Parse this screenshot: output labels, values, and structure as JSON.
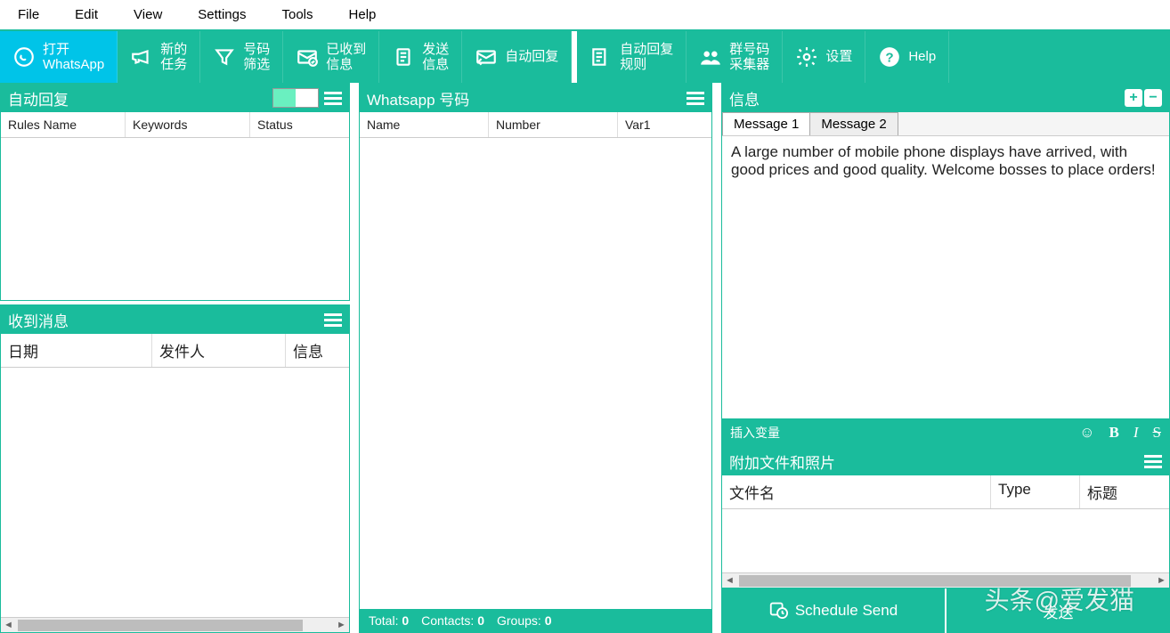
{
  "menubar": [
    "File",
    "Edit",
    "View",
    "Settings",
    "Tools",
    "Help"
  ],
  "toolbar": [
    {
      "id": "open-whatsapp",
      "label": "打开\nWhatsApp",
      "icon": "whatsapp",
      "active": true
    },
    {
      "id": "new-task",
      "label": "新的\n任务",
      "icon": "megaphone"
    },
    {
      "id": "number-filter",
      "label": "号码\n筛选",
      "icon": "funnel"
    },
    {
      "id": "received-msgs",
      "label": "已收到\n信息",
      "icon": "envelope-check"
    },
    {
      "id": "send-msgs",
      "label": "发送\n信息",
      "icon": "clipboard"
    },
    {
      "id": "auto-reply",
      "label": "自动回复",
      "icon": "reply"
    },
    {
      "id": "auto-reply-rules",
      "label": "自动回复\n规则",
      "icon": "rules",
      "gapBefore": true
    },
    {
      "id": "group-collector",
      "label": "群号码\n采集器",
      "icon": "people"
    },
    {
      "id": "settings",
      "label": "设置",
      "icon": "gear"
    },
    {
      "id": "help",
      "label": "Help",
      "icon": "help"
    }
  ],
  "panels": {
    "autoReply": {
      "title": "自动回复",
      "columns": [
        "Rules Name",
        "Keywords",
        "Status"
      ]
    },
    "received": {
      "title": "收到消息",
      "columns": [
        "日期",
        "发件人",
        "信息"
      ]
    },
    "numbers": {
      "title": "Whatsapp 号码",
      "columns": [
        "Name",
        "Number",
        "Var1"
      ]
    },
    "messages": {
      "title": "信息",
      "tabs": [
        "Message 1",
        "Message 2"
      ],
      "activeTab": 0,
      "body": "A large number of mobile phone displays have arrived, with good prices and good quality. Welcome bosses to place orders!"
    },
    "insertVar": {
      "title": "插入变量"
    },
    "attachments": {
      "title": "附加文件和照片",
      "columns": [
        "文件名",
        "Type",
        "标题"
      ]
    }
  },
  "statusStrip": {
    "totalLabel": "Total:",
    "totalValue": "0",
    "contactsLabel": "Contacts:",
    "contactsValue": "0",
    "groupsLabel": "Groups:",
    "groupsValue": "0"
  },
  "buttons": {
    "schedule": "Schedule Send",
    "sendNow": "发送"
  },
  "watermark": "头条@爱发猫"
}
